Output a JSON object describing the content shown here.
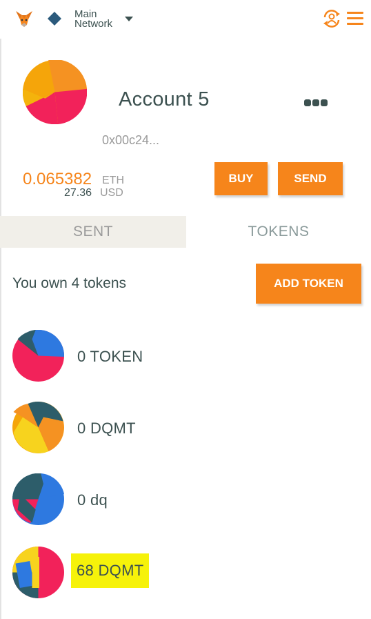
{
  "header": {
    "network_line1": "Main",
    "network_line2": "Network",
    "icons": [
      "metamask-fox-icon",
      "network-diamond-icon",
      "chevron-down-icon",
      "account-sync-icon",
      "hamburger-menu-icon"
    ]
  },
  "account": {
    "name": "Account 5",
    "address": "0x00c24...",
    "balance_eth": "0.065382",
    "balance_eth_unit": "ETH",
    "balance_usd": "27.36",
    "balance_usd_unit": "USD"
  },
  "actions": {
    "buy_label": "BUY",
    "send_label": "SEND"
  },
  "tabs": [
    {
      "label": "SENT",
      "active": false
    },
    {
      "label": "TOKENS",
      "active": true
    }
  ],
  "tokens_section": {
    "summary": "You own 4 tokens",
    "add_token_label": "ADD TOKEN"
  },
  "tokens": [
    {
      "label": "0 TOKEN",
      "highlighted": false
    },
    {
      "label": "0 DQMT",
      "highlighted": false
    },
    {
      "label": "0 dq",
      "highlighted": false
    },
    {
      "label": "68 DQMT",
      "highlighted": true
    }
  ],
  "colors": {
    "accent": "#f6851b",
    "text": "#3c5150",
    "muted": "#9a9a9a",
    "highlight": "#f6f20a"
  }
}
